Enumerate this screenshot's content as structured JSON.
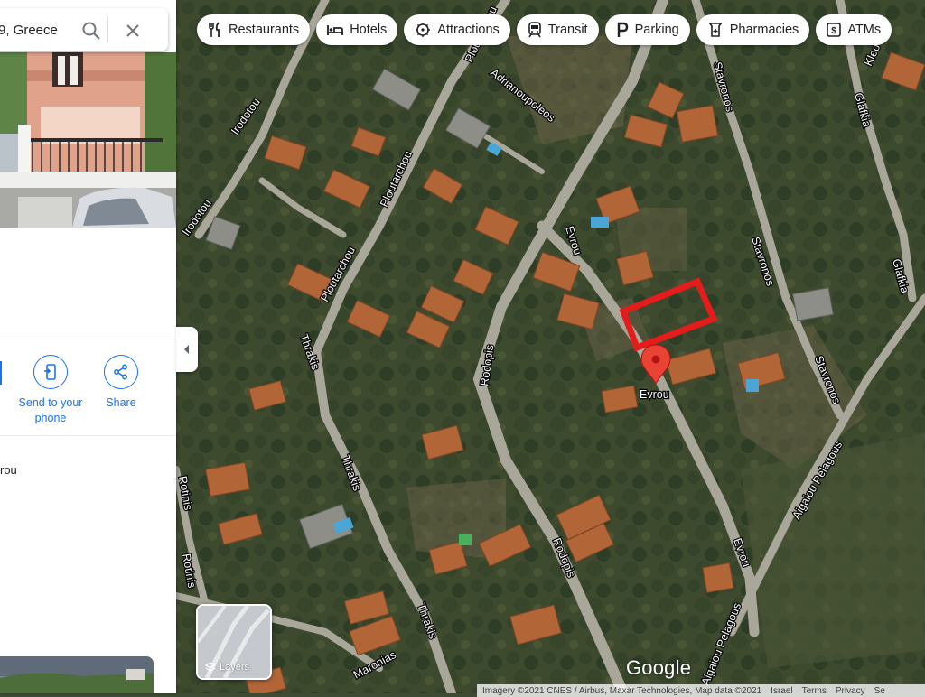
{
  "search": {
    "query": "9, Greece"
  },
  "actions": [
    {
      "label": "Send to your phone",
      "icon": "send-to-phone-icon"
    },
    {
      "label": "Share",
      "icon": "share-icon"
    }
  ],
  "address_snippet": "rou",
  "chips": [
    {
      "label": "Restaurants",
      "icon": "restaurant-icon"
    },
    {
      "label": "Hotels",
      "icon": "hotel-icon"
    },
    {
      "label": "Attractions",
      "icon": "attractions-icon"
    },
    {
      "label": "Transit",
      "icon": "transit-icon"
    },
    {
      "label": "Parking",
      "icon": "parking-icon"
    },
    {
      "label": "Pharmacies",
      "icon": "pharmacy-icon"
    },
    {
      "label": "ATMs",
      "icon": "atm-icon"
    }
  ],
  "layers_label": "Layers",
  "brand": "Google",
  "footer": {
    "imagery": "Imagery ©2021 CNES / Airbus, Maxar Technologies, Map data ©2021",
    "links": [
      "Israel",
      "Terms",
      "Privacy",
      "Se"
    ]
  },
  "streets": {
    "evrou": "Evrou",
    "evrou2": "Evrou",
    "rodopis": "Rodopis",
    "rodopis2": "Rodopis",
    "thrakis": "Thrakis",
    "thrakis2": "Thrakis",
    "thrakis3": "Thrakis",
    "ploutarchou": "Ploutarchou",
    "ploutarchou2": "Ploutarchou",
    "ploutarchou3": "Ploutarchou",
    "adrianoupoleos": "Adrianoupoleos",
    "stavronos": "Stavronos",
    "stavronos2": "Stavronos",
    "stavronos3": "Stavronos",
    "glafkia": "Glafkia",
    "glafkia2": "Glafkia",
    "irodotou": "Irodotou",
    "irodotou2": "Irodotou",
    "aigaiou": "Aigaiou Pelagous",
    "aigaiou2": "Aigaiou Pelagous",
    "maronias": "Maronias",
    "kleo": "Kleo",
    "rotinis": "Rotinis"
  },
  "colors": {
    "pin": "#ea4335",
    "plot_outline": "#e51c1c",
    "accent": "#1a73e8"
  }
}
